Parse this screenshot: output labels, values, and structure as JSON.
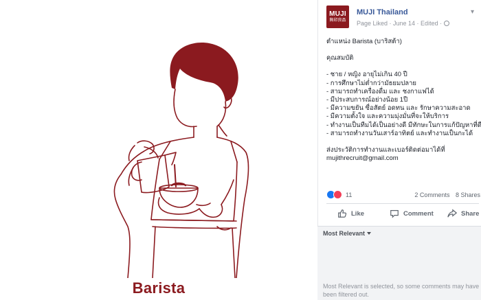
{
  "photo": {
    "caption": "Barista",
    "accent_color": "#8b1a1f"
  },
  "post": {
    "page_name": "MUJI Thailand",
    "avatar_text": "MUJI",
    "avatar_subtext": "無印良品",
    "meta_line": "Page Liked · June 14 · Edited ·",
    "lines": [
      "ตำแหน่ง Barista (บาริสต้า)",
      "",
      "คุณสมบัติ",
      "",
      "- ชาย / หญิง อายุไม่เกิน 40 ปี",
      "- การศึกษาไม่ต่ำกว่ามัธยมปลาย",
      "- สามารถทำเครื่องดื่ม และ ชงกาแฟได้",
      "- มีประสบการณ์อย่างน้อย 1ปี",
      "- มีความขยัน ซื่อสัตย์ อดทน และ รักษาความสะอาด",
      "- มีความตั้งใจ และความมุ่งมั่นที่จะให้บริการ",
      "- ทำงานเป็นทีมได้เป็นอย่างดี มีทักษะในการแก้ปัญหาที่ดี",
      "- สามารถทำงานวันเสาร์อาทิตย์ และทำงานเป็นกะได้",
      "",
      "ส่งประวัติการทำงานและเบอร์ติดต่อมาได้ที่",
      "mujithrecruit@gmail.com"
    ]
  },
  "reactions": {
    "count": "11",
    "comments": "2 Comments",
    "shares": "8 Shares"
  },
  "actions": {
    "like": "Like",
    "comment": "Comment",
    "share": "Share"
  },
  "comments": {
    "sort_label": "Most Relevant",
    "filter_note": "Most Relevant is selected, so some comments may have been filtered out."
  },
  "icons": {
    "like_reaction": "like-reaction-icon",
    "love_reaction": "love-reaction-icon",
    "globe": "globe-icon",
    "options": "chevron-down-icon"
  },
  "colors": {
    "link_blue": "#385898",
    "like_blue": "#1877f2",
    "love_red": "#f33e58"
  }
}
